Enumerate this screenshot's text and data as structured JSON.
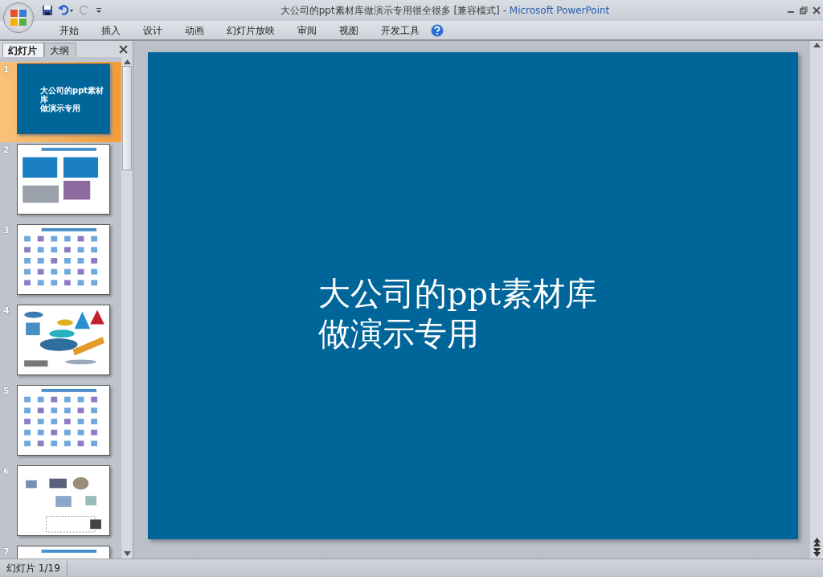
{
  "window": {
    "title": "大公司的ppt素材库做演示专用很全很多 [兼容模式]",
    "separator": "-",
    "app_name": "Microsoft PowerPoint"
  },
  "ribbon_tabs": [
    "开始",
    "插入",
    "设计",
    "动画",
    "幻灯片放映",
    "审阅",
    "视图",
    "开发工具"
  ],
  "pane_tabs": [
    {
      "label": "幻灯片",
      "selected": true
    },
    {
      "label": "大纲",
      "selected": false
    }
  ],
  "slides": [
    {
      "number": "1",
      "selected": true,
      "kind": "title",
      "title_lines": [
        "大公司的ppt素材库",
        "做演示专用"
      ]
    },
    {
      "number": "2",
      "selected": false,
      "kind": "tables"
    },
    {
      "number": "3",
      "selected": false,
      "kind": "icons"
    },
    {
      "number": "4",
      "selected": false,
      "kind": "shapes"
    },
    {
      "number": "5",
      "selected": false,
      "kind": "icons"
    },
    {
      "number": "6",
      "selected": false,
      "kind": "clipart"
    },
    {
      "number": "7",
      "selected": false,
      "kind": "tables"
    }
  ],
  "slide_view": {
    "title_lines": [
      "大公司的ppt素材库",
      "做演示专用"
    ]
  },
  "status_bar": {
    "slide_indicator": "幻灯片 1/19"
  }
}
